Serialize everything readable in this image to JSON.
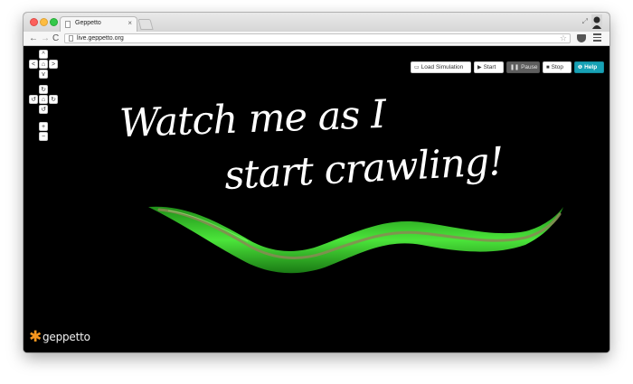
{
  "browser": {
    "tab_title": "Geppetto",
    "tab_close": "×",
    "url": "live.geppetto.org",
    "nav_back": "←",
    "nav_forward": "→",
    "nav_reload": "C",
    "star": "☆"
  },
  "camera_controls": {
    "pan_up": "^",
    "pan_left": "<",
    "home": "⌂",
    "pan_right": ">",
    "pan_down": "v",
    "rotate_up": "↻",
    "rotate_left": "↺",
    "rotate_home": "⌂",
    "rotate_right": "↻",
    "rotate_down": "↺",
    "zoom_in": "+",
    "zoom_out": "−"
  },
  "simulation_toolbar": {
    "load_icon": "▭",
    "load_label": "Load Simulation",
    "start_icon": "▶",
    "start_label": "Start",
    "pause_icon": "❚❚",
    "pause_label": "Pause",
    "stop_icon": "■",
    "stop_label": "Stop",
    "help_icon": "❶",
    "help_label": "Help"
  },
  "headline": {
    "line1": "Watch me as I",
    "line2": "start crawling!"
  },
  "logo": {
    "star": "✱",
    "text": "geppetto"
  },
  "colors": {
    "accent_help": "#17a1b5",
    "logo_orange": "#f5951e",
    "worm_green": "#35d62a",
    "worm_core": "#8a8a55"
  }
}
